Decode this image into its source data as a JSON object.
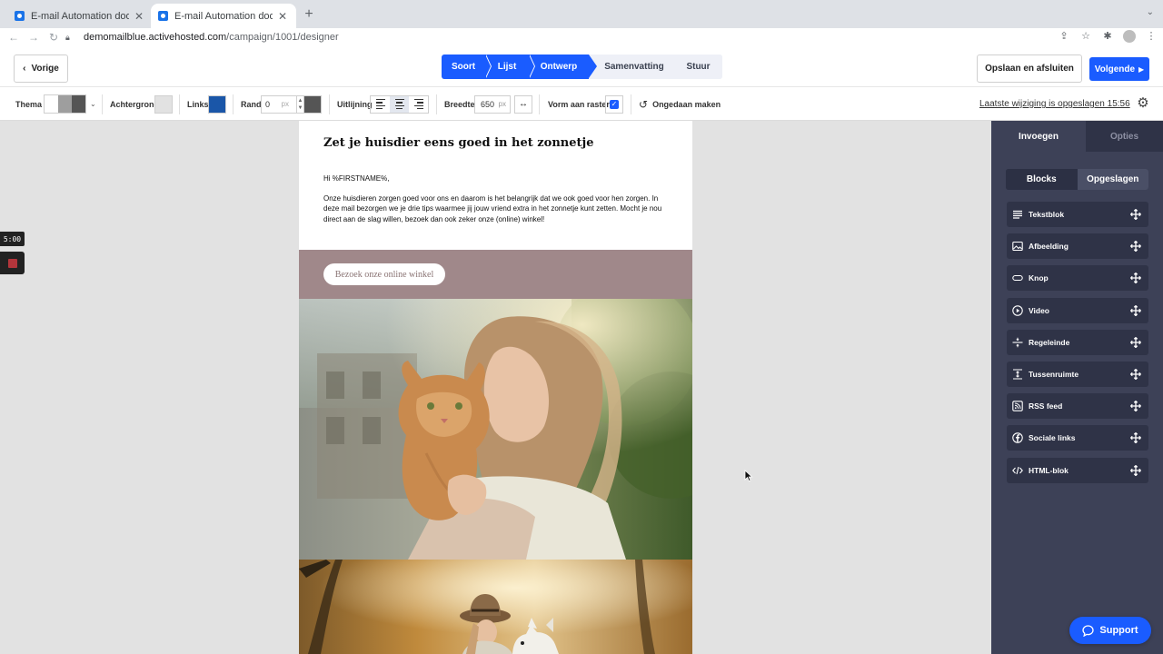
{
  "browser": {
    "tabs": [
      {
        "title": "E-mail Automation door MailBl",
        "state": "inactive"
      },
      {
        "title": "E-mail Automation door MailBl",
        "state": "active"
      }
    ],
    "url_host": "demomailblue.activehosted.com",
    "url_path": "/campaign/1001/designer"
  },
  "header": {
    "back_label": "Vorige",
    "steps": [
      {
        "label": "Soort",
        "state": "done"
      },
      {
        "label": "Lijst",
        "state": "done"
      },
      {
        "label": "Ontwerp",
        "state": "current"
      },
      {
        "label": "Samenvatting",
        "state": "todo"
      },
      {
        "label": "Stuur",
        "state": "todo"
      }
    ],
    "save_close_label": "Opslaan en afsluiten",
    "next_label": "Volgende"
  },
  "toolbar": {
    "theme_label": "Thema",
    "theme_swatches": [
      "#ffffff",
      "#9e9e9e",
      "#555555"
    ],
    "background_label": "Achtergrond",
    "background_color": "#e2e2e2",
    "links_label": "Links",
    "links_color": "#1a56a8",
    "border_label": "Rand",
    "border_value": "0",
    "border_unit": "px",
    "border_color": "#555555",
    "alignment_label": "Uitlijning",
    "alignment_selected": "center",
    "width_label": "Breedte",
    "width_value": "650",
    "width_unit": "px",
    "snap_label": "Vorm aan raster",
    "snap_checked": true,
    "undo_label": "Ongedaan maken",
    "last_saved": "Laatste wijziging is opgeslagen 15:56"
  },
  "email": {
    "title": "Zet je huisdier eens goed in het zonnetje",
    "greeting": "Hi %FIRSTNAME%,",
    "body": "Onze huisdieren zorgen goed voor ons en daarom is het belangrijk dat we ook goed voor hen zorgen. In deze mail bezorgen we je drie tips waarmee jij jouw vriend extra in het zonnetje kunt zetten. Mocht je nou direct aan de slag willen, bezoek dan ook zeker onze (online) winkel!",
    "button_label": "Bezoek onze online winkel",
    "band_color": "#a0888a"
  },
  "recorder": {
    "timer": "5:00"
  },
  "panel": {
    "tabs": [
      {
        "label": "Invoegen",
        "state": "active"
      },
      {
        "label": "Opties",
        "state": "inactive"
      }
    ],
    "subtabs": [
      {
        "label": "Blocks",
        "state": "active"
      },
      {
        "label": "Opgeslagen",
        "state": "inactive"
      }
    ],
    "blocks": [
      {
        "label": "Tekstblok",
        "icon": "text-icon"
      },
      {
        "label": "Afbeelding",
        "icon": "image-icon"
      },
      {
        "label": "Knop",
        "icon": "button-icon"
      },
      {
        "label": "Video",
        "icon": "play-icon"
      },
      {
        "label": "Regeleinde",
        "icon": "divider-icon"
      },
      {
        "label": "Tussenruimte",
        "icon": "spacer-icon"
      },
      {
        "label": "RSS feed",
        "icon": "rss-icon"
      },
      {
        "label": "Sociale links",
        "icon": "facebook-icon"
      },
      {
        "label": "HTML-blok",
        "icon": "code-icon"
      }
    ]
  },
  "support": {
    "label": "Support"
  }
}
